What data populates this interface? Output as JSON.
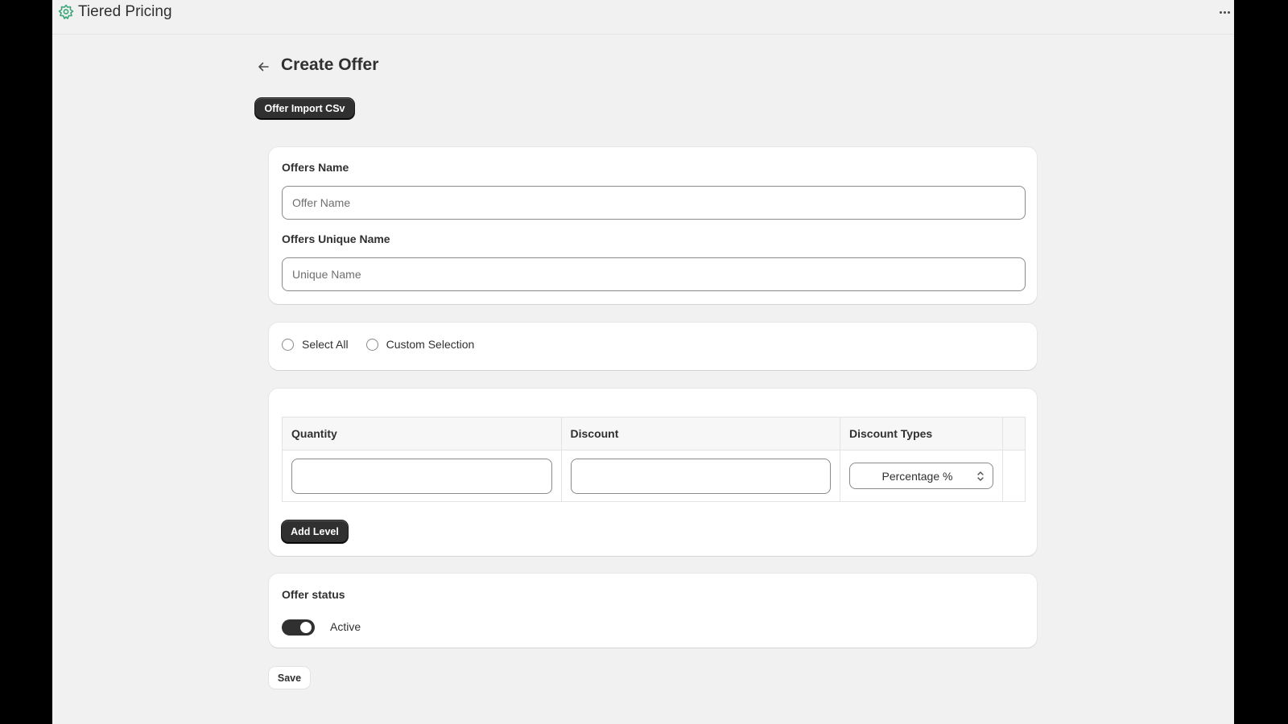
{
  "app": {
    "title": "Tiered Pricing",
    "logo_icon": "tiered-pricing-logo-icon",
    "more_icon": "more-horizontal-icon"
  },
  "header": {
    "back_icon": "arrow-left-icon",
    "title": "Create Offer",
    "import_button": "Offer Import CSv"
  },
  "names_card": {
    "offer_name_label": "Offers Name",
    "offer_name_value": "",
    "offer_name_placeholder": "Offer Name",
    "unique_name_label": "Offers Unique Name",
    "unique_name_value": "",
    "unique_name_placeholder": "Unique Name"
  },
  "selection_card": {
    "options": [
      {
        "label": "Select All",
        "selected": false
      },
      {
        "label": "Custom Selection",
        "selected": false
      }
    ]
  },
  "levels_card": {
    "columns": [
      "Quantity",
      "Discount",
      "Discount Types",
      ""
    ],
    "rows": [
      {
        "quantity": "",
        "discount": "",
        "discount_type": "Percentage %"
      }
    ],
    "add_level_button": "Add Level"
  },
  "status_card": {
    "title": "Offer status",
    "toggle_on": true,
    "toggle_label": "Active"
  },
  "save_button": "Save",
  "colors": {
    "page_background": "#f1f1f1",
    "card_background": "#ffffff",
    "primary_button": "#303030",
    "text": "#303030",
    "logo_green": "#3aa676"
  }
}
